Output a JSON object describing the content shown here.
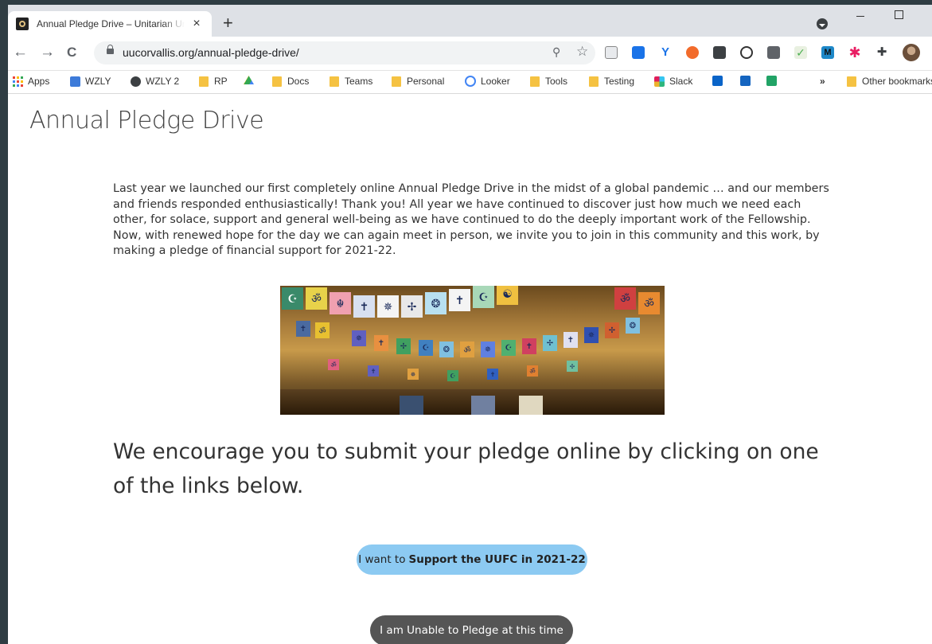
{
  "browser": {
    "tab": {
      "title": "Annual Pledge Drive – Unitarian Universalist Fellowship",
      "close": "×"
    },
    "new_tab": "+",
    "nav": {
      "back": "←",
      "forward": "→",
      "reload": "C"
    },
    "address": {
      "url": "uucorvallis.org/annual-pledge-drive/",
      "zoom": "⚲",
      "star": "☆"
    },
    "bookmarks": [
      {
        "label": "Apps"
      },
      {
        "label": "WZLY"
      },
      {
        "label": "WZLY 2"
      },
      {
        "label": "RP"
      },
      {
        "label": "Docs"
      },
      {
        "label": "Teams"
      },
      {
        "label": "Personal"
      },
      {
        "label": "Looker"
      },
      {
        "label": "Tools"
      },
      {
        "label": "Testing"
      },
      {
        "label": "Slack"
      }
    ],
    "more_bookmarks": "»",
    "other_bookmarks": "Other bookmarks"
  },
  "page": {
    "title": "Annual Pledge Drive",
    "intro": "Last year we launched our first completely online Annual Pledge Drive in the midst of a global pandemic … and our members and friends responded enthusiastically!  Thank you!  All year we have continued to discover just how much we need each other, for solace, support and general well-being as we have continued to do the deeply important work of the Fellowship. Now, with renewed hope for the day we can again meet in person, we invite you to join in this community and this work, by making a pledge of financial support for 2021-22.",
    "lead": "We encourage you to submit your pledge online by clicking on one of the links below.",
    "support_button": {
      "prefix": "I want to",
      "bold": "Support the UUFC in 2021-22"
    },
    "unable_button": "I am Unable to Pledge at this time"
  }
}
